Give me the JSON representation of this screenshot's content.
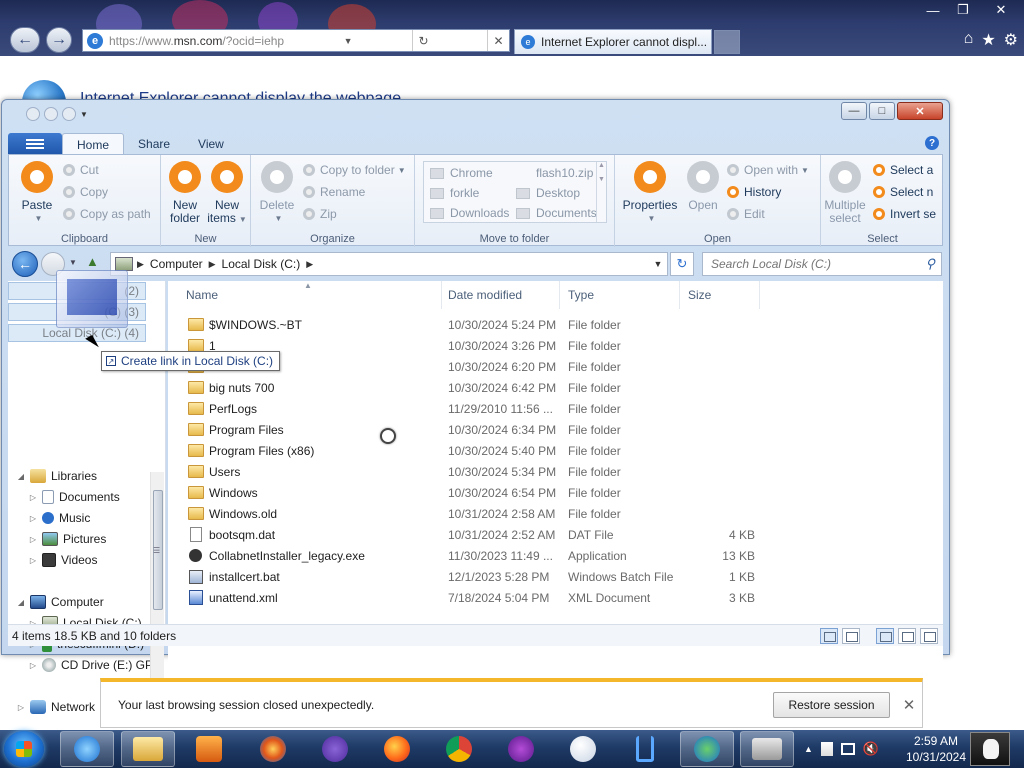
{
  "browser": {
    "url_prefix": "https://www.",
    "url_host": "msn.com",
    "url_suffix": "/?ocid=iehp",
    "tab_title": "Internet Explorer cannot displ...",
    "error_heading": "Internet Explorer cannot display the webpage"
  },
  "explorer": {
    "ribbon_tabs": [
      "Home",
      "Share",
      "View"
    ],
    "clipboard": {
      "label": "Clipboard",
      "paste": "Paste",
      "cut": "Cut",
      "copy": "Copy",
      "copy_path": "Copy as path"
    },
    "new": {
      "label": "New",
      "new_folder": "New\nfolder",
      "new_folder_l1": "New",
      "new_folder_l2": "folder",
      "new_items_l1": "New",
      "new_items_l2": "items"
    },
    "organize": {
      "label": "Organize",
      "delete": "Delete",
      "copy_to_folder": "Copy to folder",
      "rename": "Rename",
      "zip": "Zip"
    },
    "move_to_folder": {
      "label": "Move to folder",
      "items": [
        "Chrome",
        "flash10.zip",
        "forkle",
        "Desktop",
        "Downloads",
        "Documents"
      ]
    },
    "open": {
      "label": "Open",
      "properties": "Properties",
      "open": "Open",
      "open_with": "Open with",
      "history": "History",
      "edit": "Edit"
    },
    "select": {
      "label": "Select",
      "multiple_select_l1": "Multiple",
      "multiple_select_l2": "select",
      "select_all": "Select a",
      "select_none": "Select n",
      "invert": "Invert se"
    },
    "address": {
      "crumbs": [
        "Computer",
        "Local Disk (C:)"
      ]
    },
    "search_placeholder": "Search Local Disk (C:)",
    "nav": {
      "ghost_rows": [
        "(2)",
        "(C) (3)",
        "Local Disk (C:) (4)"
      ],
      "libraries": "Libraries",
      "library_items": [
        "Documents",
        "Music",
        "Pictures",
        "Videos"
      ],
      "computer": "Computer",
      "computer_items": [
        "Local Disk (C:)",
        "thescuffmini (D:)",
        "CD Drive (E:) GPa"
      ],
      "network": "Network"
    },
    "drag_tooltip": "Create link in Local Disk (C:)",
    "columns": {
      "name": "Name",
      "date": "Date modified",
      "type": "Type",
      "size": "Size"
    },
    "files": [
      {
        "name": "$WINDOWS.~BT",
        "date": "10/30/2024 5:24 PM",
        "type": "File folder",
        "size": "",
        "kind": "folder"
      },
      {
        "name": "1",
        "date": "10/30/2024 3:26 PM",
        "type": "File folder",
        "size": "",
        "kind": "folder"
      },
      {
        "name": "",
        "date": "10/30/2024 6:20 PM",
        "type": "File folder",
        "size": "",
        "kind": "folder"
      },
      {
        "name": "big nuts 700",
        "date": "10/30/2024 6:42 PM",
        "type": "File folder",
        "size": "",
        "kind": "folder"
      },
      {
        "name": "PerfLogs",
        "date": "11/29/2010 11:56 ...",
        "type": "File folder",
        "size": "",
        "kind": "folder"
      },
      {
        "name": "Program Files",
        "date": "10/30/2024 6:34 PM",
        "type": "File folder",
        "size": "",
        "kind": "folder"
      },
      {
        "name": "Program Files (x86)",
        "date": "10/30/2024 5:40 PM",
        "type": "File folder",
        "size": "",
        "kind": "folder"
      },
      {
        "name": "Users",
        "date": "10/30/2024 5:34 PM",
        "type": "File folder",
        "size": "",
        "kind": "folder"
      },
      {
        "name": "Windows",
        "date": "10/30/2024 6:54 PM",
        "type": "File folder",
        "size": "",
        "kind": "folder"
      },
      {
        "name": "Windows.old",
        "date": "10/31/2024 2:58 AM",
        "type": "File folder",
        "size": "",
        "kind": "folder"
      },
      {
        "name": "bootsqm.dat",
        "date": "10/31/2024 2:52 AM",
        "type": "DAT File",
        "size": "4 KB",
        "kind": "dat"
      },
      {
        "name": "CollabnetInstaller_legacy.exe",
        "date": "11/30/2023 11:49 ...",
        "type": "Application",
        "size": "13 KB",
        "kind": "exe"
      },
      {
        "name": "installcert.bat",
        "date": "12/1/2023 5:28 PM",
        "type": "Windows Batch File",
        "size": "1 KB",
        "kind": "bat"
      },
      {
        "name": "unattend.xml",
        "date": "7/18/2024 5:04 PM",
        "type": "XML Document",
        "size": "3 KB",
        "kind": "xml"
      }
    ],
    "status": "4 items 18.5 KB and 10 folders"
  },
  "notification": {
    "message": "Your last browsing session closed unexpectedly.",
    "restore_label": "Restore session"
  },
  "taskbar": {
    "time": "2:59 AM",
    "date": "10/31/2024"
  }
}
